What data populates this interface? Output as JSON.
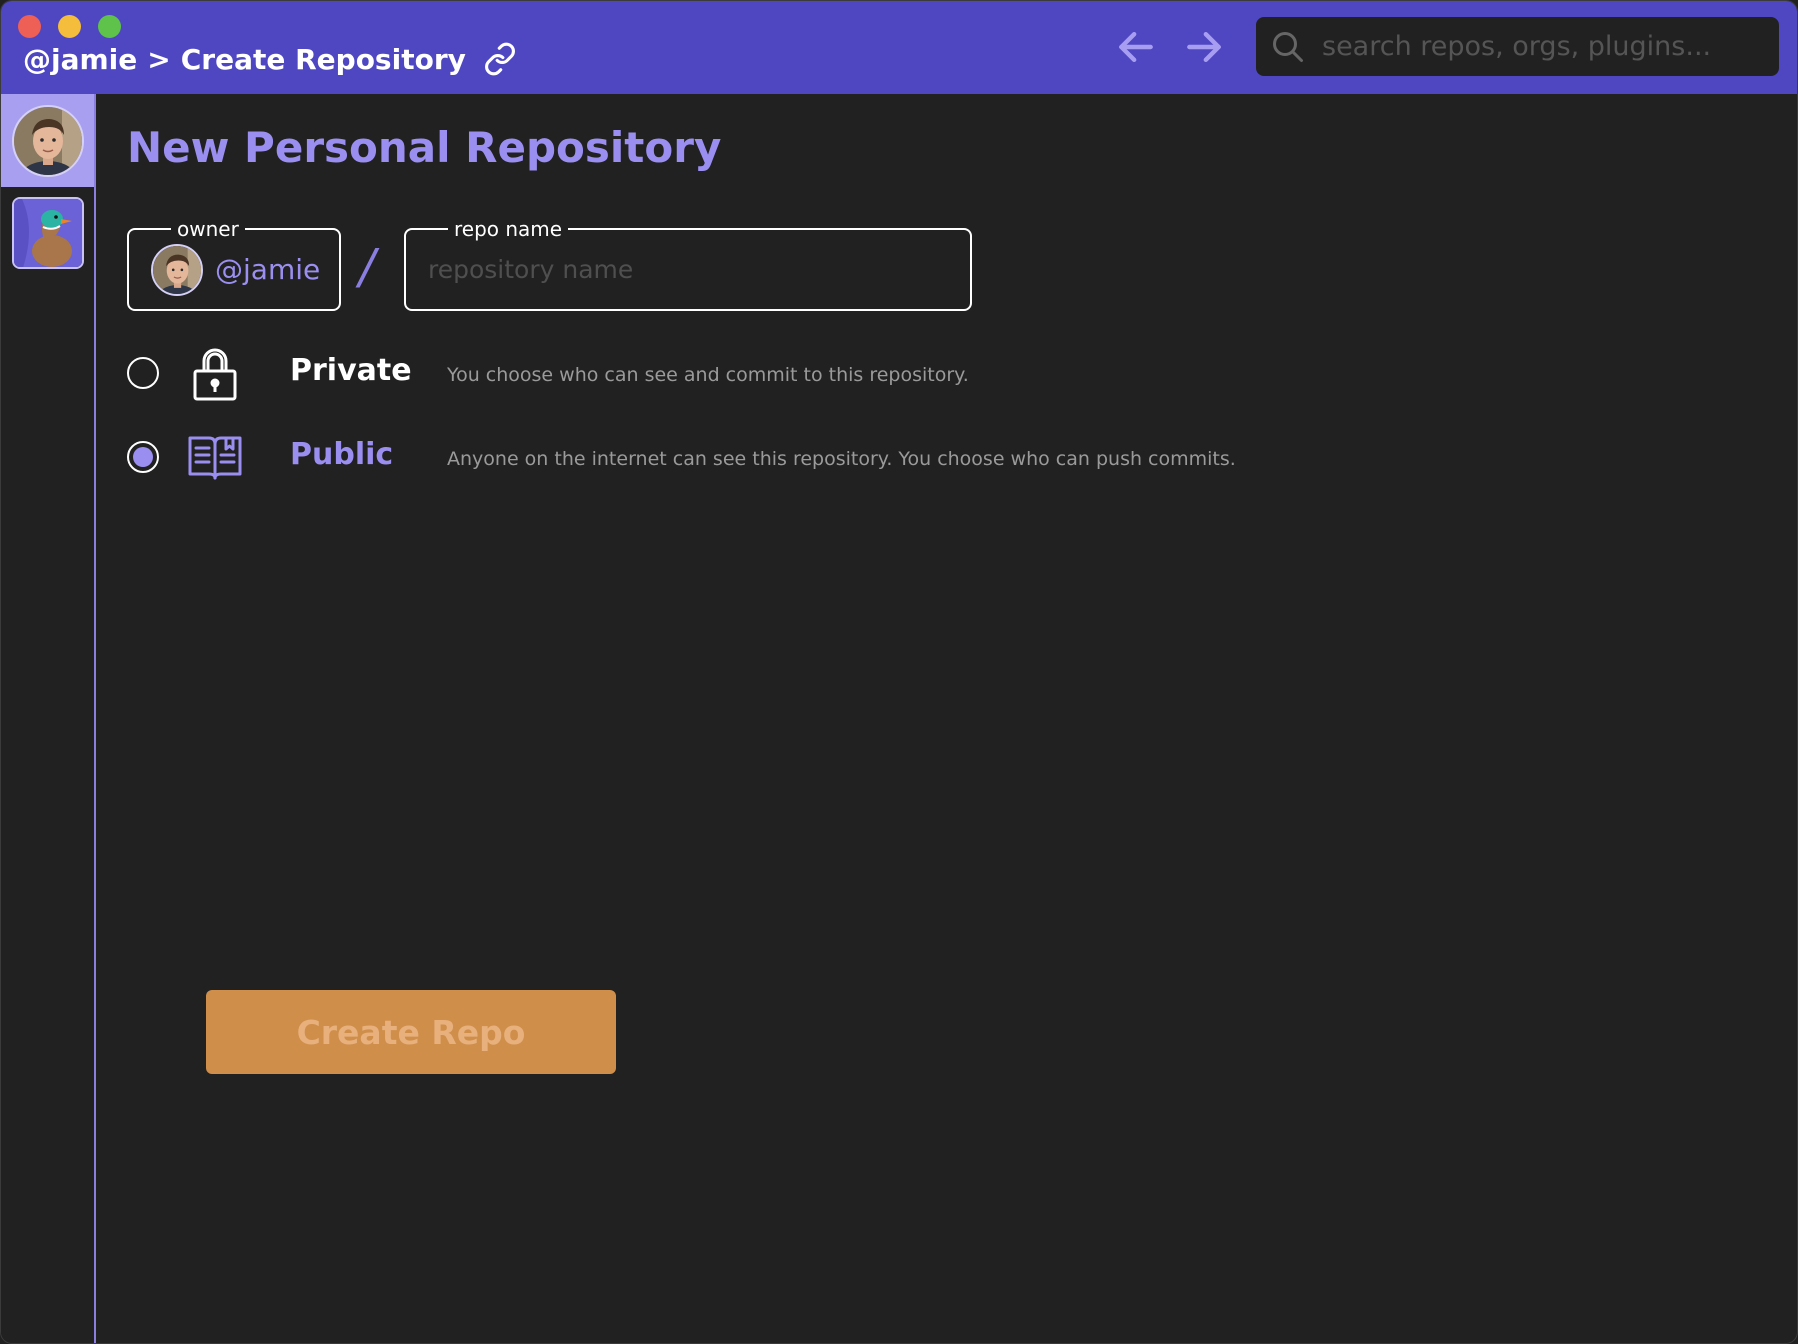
{
  "window": {
    "breadcrumb": {
      "user": "@jamie",
      "separator": ">",
      "page": "Create Repository"
    },
    "traffic_lights": [
      "close",
      "minimize",
      "maximize"
    ]
  },
  "nav": {
    "back_icon": "arrow-left-icon",
    "forward_icon": "arrow-right-icon"
  },
  "search": {
    "placeholder": "search repos, orgs, plugins...",
    "value": ""
  },
  "sidebar": {
    "items": [
      {
        "kind": "user-avatar",
        "active": true
      },
      {
        "kind": "org-logo",
        "active": false
      }
    ]
  },
  "main": {
    "title": "New Personal Repository",
    "owner": {
      "legend": "owner",
      "value": "@jamie"
    },
    "separator": "/",
    "repo_name": {
      "legend": "repo name",
      "placeholder": "repository name",
      "value": ""
    },
    "visibility": [
      {
        "id": "private",
        "icon": "lock-icon",
        "label": "Private",
        "description": "You choose who can see and commit to this repository.",
        "selected": false
      },
      {
        "id": "public",
        "icon": "book-icon",
        "label": "Public",
        "description": "Anyone on the internet can see this repository. You choose who can push commits.",
        "selected": true
      }
    ],
    "create_button": {
      "label": "Create Repo",
      "enabled": false
    }
  },
  "colors": {
    "titlebar": "#4f47c2",
    "accent": "#9a8ff0",
    "background": "#212121",
    "button": "#cf8e4a",
    "button_text": "#e7b07c"
  }
}
